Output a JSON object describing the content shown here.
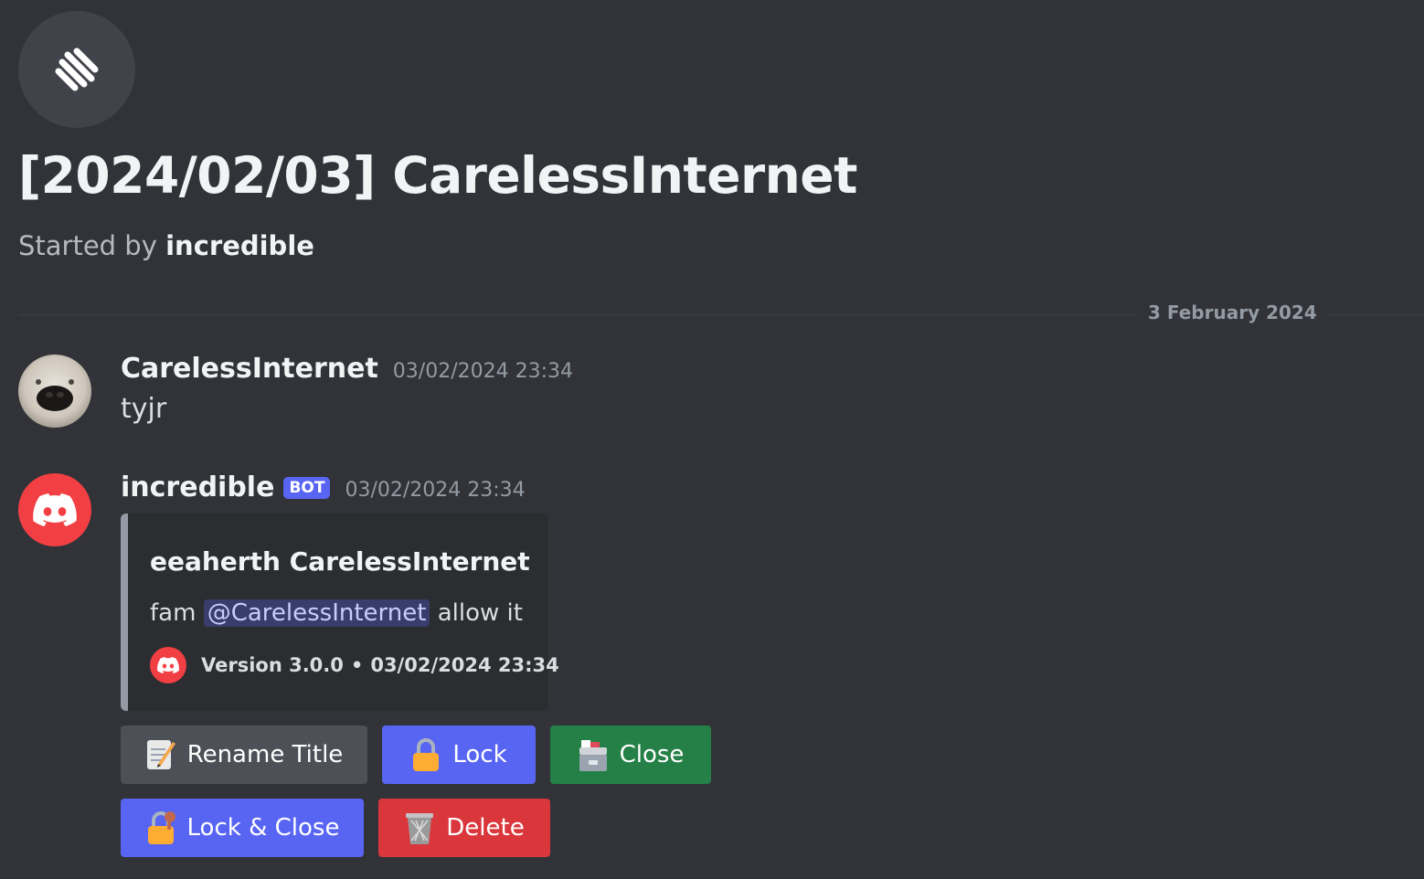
{
  "thread": {
    "title": "[2024/02/03] CarelessInternet",
    "started_by_prefix": "Started by",
    "started_by_user": "incredible",
    "icon": "thread-icon"
  },
  "divider": {
    "date": "3 February 2024"
  },
  "messages": [
    {
      "author": "CarelessInternet",
      "timestamp": "03/02/2024 23:34",
      "text": "tyjr"
    },
    {
      "author": "incredible",
      "badge": "BOT",
      "timestamp": "03/02/2024 23:34",
      "embed": {
        "title": "eeaherth CarelessInternet",
        "desc_before": "fam",
        "mention": "@CarelessInternet",
        "desc_after": "allow it",
        "footer_text": "Version 3.0.0",
        "footer_sep": "•",
        "footer_time": "03/02/2024 23:34"
      }
    }
  ],
  "buttons": {
    "rename": {
      "label": "Rename Title",
      "icon": "memo-icon",
      "color": "#4e5058"
    },
    "lock": {
      "label": "Lock",
      "icon": "lock-icon",
      "color": "#5865f2"
    },
    "close": {
      "label": "Close",
      "icon": "card-file-box-icon",
      "color": "#248046"
    },
    "lock_close": {
      "label": "Lock & Close",
      "icon": "lock-with-key-icon",
      "color": "#5865f2"
    },
    "delete": {
      "label": "Delete",
      "icon": "wastebasket-icon",
      "color": "#da373c"
    }
  }
}
